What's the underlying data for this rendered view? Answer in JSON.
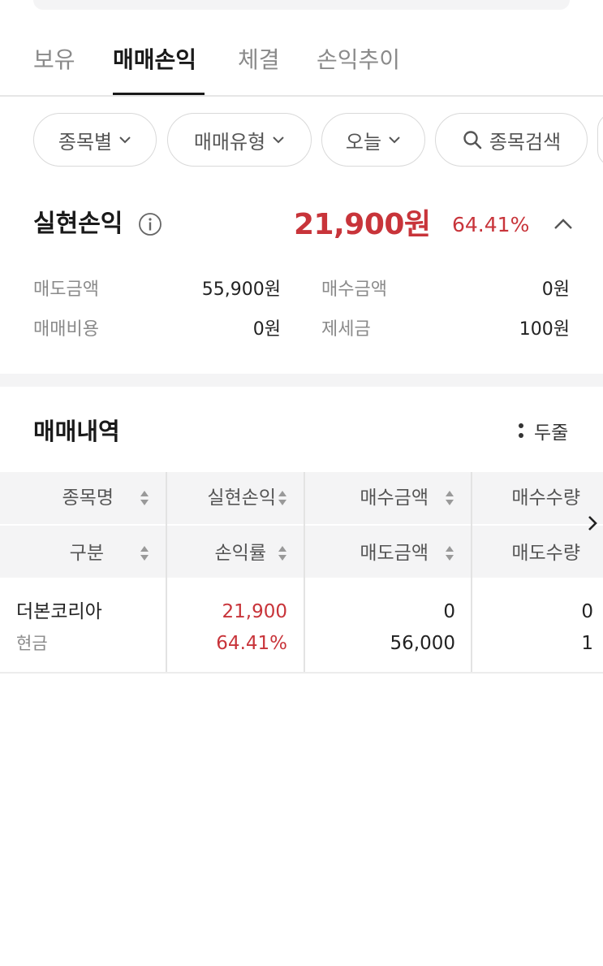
{
  "tabs": [
    {
      "label": "보유",
      "active": false
    },
    {
      "label": "매매손익",
      "active": true
    },
    {
      "label": "체결",
      "active": false
    },
    {
      "label": "손익추이",
      "active": false
    }
  ],
  "filters": {
    "by_stock": "종목별",
    "trade_type": "매매유형",
    "period": "오늘",
    "search": "종목검색"
  },
  "summary": {
    "title": "실현손익",
    "amount": "21,900원",
    "rate": "64.41%",
    "sell_amount_label": "매도금액",
    "sell_amount_value": "55,900원",
    "buy_amount_label": "매수금액",
    "buy_amount_value": "0원",
    "trade_cost_label": "매매비용",
    "trade_cost_value": "0원",
    "tax_label": "제세금",
    "tax_value": "100원"
  },
  "history": {
    "title": "매매내역",
    "view_toggle": "두줄",
    "headers": {
      "row1": [
        "종목명",
        "실현손익",
        "매수금액",
        "매수수량"
      ],
      "row2": [
        "구분",
        "손익률",
        "매도금액",
        "매도수량"
      ]
    },
    "rows": [
      {
        "name": "더본코리아",
        "type": "현금",
        "realized_pl": "21,900",
        "pl_rate": "64.41%",
        "buy_amount": "0",
        "sell_amount": "56,000",
        "buy_qty": "0",
        "sell_qty": "1"
      }
    ]
  },
  "colors": {
    "profit_red": "#c8343a",
    "text_dark": "#1a1a1a",
    "text_gray": "#8a8a8a",
    "surface_gray": "#f4f4f5"
  }
}
